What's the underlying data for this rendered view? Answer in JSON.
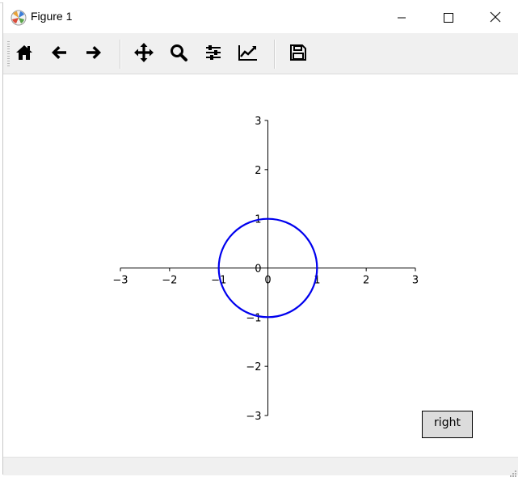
{
  "window": {
    "title": "Figure 1"
  },
  "toolbar": {
    "buttons": [
      {
        "name": "home",
        "icon": "home-icon"
      },
      {
        "name": "back",
        "icon": "arrow-left-icon"
      },
      {
        "name": "forward",
        "icon": "arrow-right-icon"
      },
      {
        "name": "pan",
        "icon": "move-icon"
      },
      {
        "name": "zoom",
        "icon": "magnifier-icon"
      },
      {
        "name": "configure-subplots",
        "icon": "sliders-icon"
      },
      {
        "name": "edit-axes",
        "icon": "line-chart-icon"
      },
      {
        "name": "save",
        "icon": "floppy-disk-icon"
      }
    ]
  },
  "chart_data": {
    "type": "line",
    "title": "",
    "xlabel": "",
    "ylabel": "",
    "xlim": [
      -3,
      3
    ],
    "ylim": [
      -3,
      3
    ],
    "x_ticks": [
      "−3",
      "−2",
      "−1",
      "0",
      "1",
      "2",
      "3"
    ],
    "y_ticks": [
      "−3",
      "−2",
      "−1",
      "0",
      "1",
      "2",
      "3"
    ],
    "x_tick_values": [
      -3,
      -2,
      -1,
      0,
      1,
      2,
      3
    ],
    "y_tick_values": [
      -3,
      -2,
      -1,
      0,
      1,
      2,
      3
    ],
    "spines": "centered",
    "grid": false,
    "series": [
      {
        "shape": "circle",
        "center": [
          0,
          0
        ],
        "radius": 1,
        "color": "#0000ee"
      }
    ]
  },
  "widgets": {
    "right_button_label": "right"
  }
}
